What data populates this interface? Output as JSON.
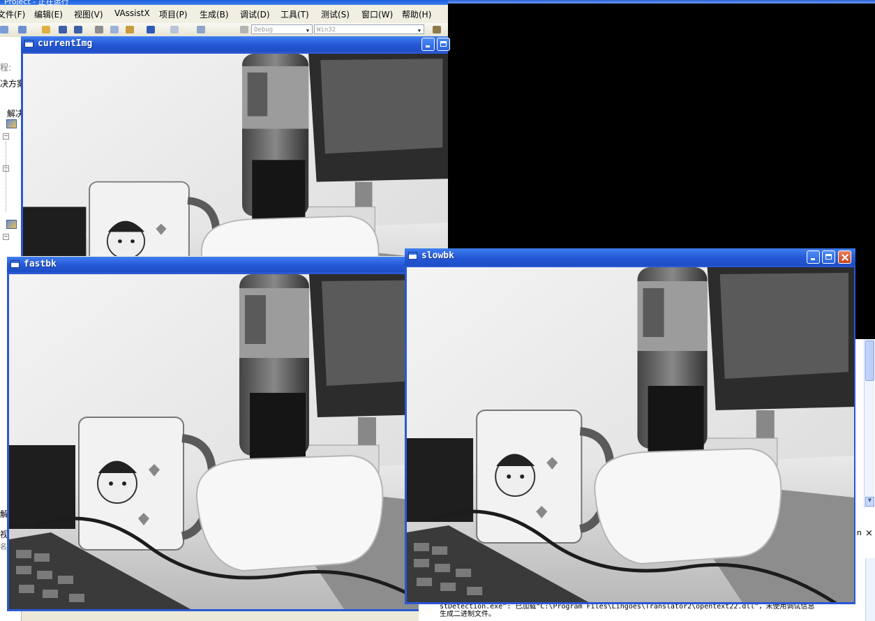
{
  "vs": {
    "title": "Project - 正在运行",
    "menu": [
      "文件(F)",
      "编辑(E)",
      "视图(V)",
      "VAssistX",
      "项目(P)",
      "生成(B)",
      "调试(D)",
      "工具(T)",
      "测试(S)",
      "窗口(W)",
      "帮助(H)"
    ],
    "config_combo": "Debug",
    "platform_combo": "Win32",
    "left_panel": {
      "labels": [
        "程:",
        "决方案",
        "解决"
      ],
      "bottom_labels": [
        "解",
        "视",
        "名称"
      ]
    },
    "output_lines": [
      "stDetection.exe”: 已加载“C:\\Program Files\\Lingoes\\Translator2\\opentext22.dll”，未使用调试信息",
      "生成二进制文件。"
    ],
    "output_close": "×",
    "partial_glyph": "n"
  },
  "windows": {
    "current": {
      "title": "currentImg"
    },
    "fast": {
      "title": "fastbk"
    },
    "slow": {
      "title": "slowbk"
    }
  },
  "colors": {
    "xp_blue": "#2a58d4",
    "close_red": "#c94320",
    "vs_bg": "#ece9d8"
  }
}
